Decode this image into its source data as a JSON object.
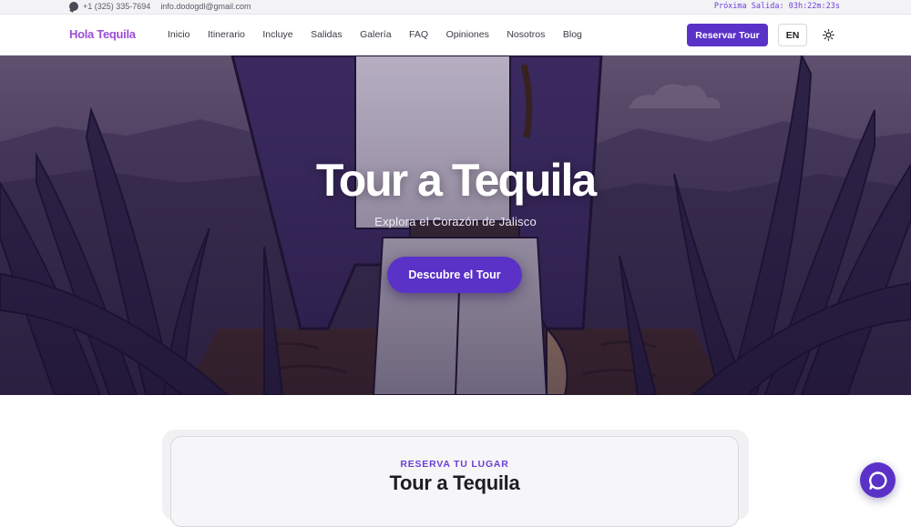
{
  "topbar": {
    "phone": "+1 (325) 335-7694",
    "email": "info.dodogdl@gmail.com",
    "countdown": "Próxima Salida: 03h:22m:23s",
    "phone_icon": "whatsapp-icon"
  },
  "header": {
    "logo": "Hola Tequila",
    "nav": [
      "Inicio",
      "Itinerario",
      "Incluye",
      "Salidas",
      "Galería",
      "FAQ",
      "Opiniones",
      "Nosotros",
      "Blog"
    ],
    "cta_label": "Reservar Tour",
    "lang_label": "EN",
    "theme_icon": "sun-icon"
  },
  "hero": {
    "title": "Tour a Tequila",
    "subtitle": "Explora el Corazón de Jalisco",
    "button_label": "Descubre el Tour"
  },
  "booking": {
    "eyebrow": "RESERVA TU LUGAR",
    "title": "Tour a Tequila"
  },
  "chat": {
    "icon": "chat-bubble-icon"
  },
  "colors": {
    "accent": "#5a32c8",
    "logo": "#9b4fd6",
    "countdown": "#6b3fd4",
    "hero_overlay": "#3b2a55"
  }
}
